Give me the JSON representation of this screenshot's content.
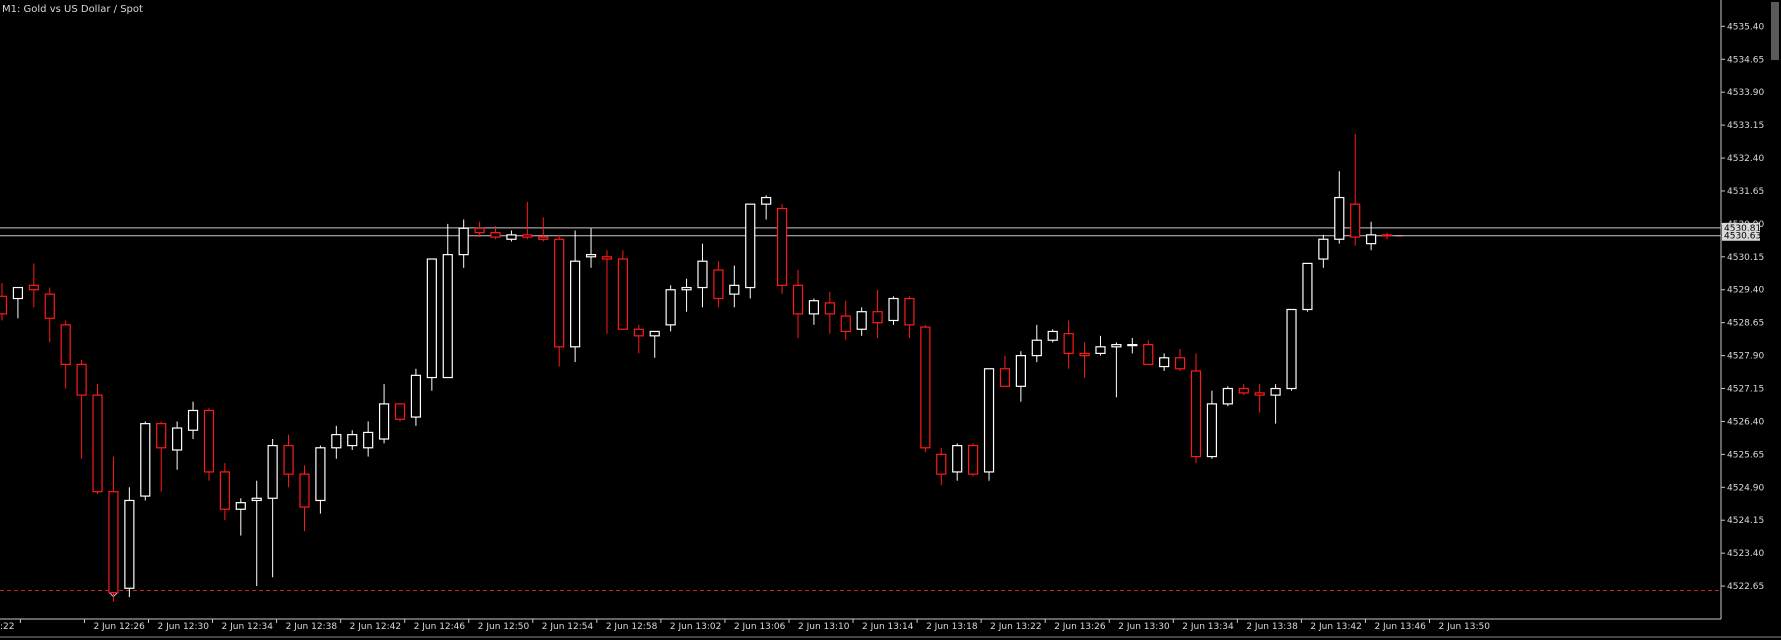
{
  "chart_data": {
    "type": "candlestick",
    "title": "M1:  Gold vs US Dollar / Spot",
    "up_color": "#ffffff",
    "down_color": "#ff1a1a",
    "background": "#000000",
    "ylim": [
      4521.9,
      4536.0
    ],
    "y_ticks": [
      "4535.40",
      "4534.65",
      "4533.90",
      "4533.15",
      "4532.40",
      "4531.65",
      "4530.90",
      "4530.15",
      "4529.40",
      "4528.65",
      "4527.90",
      "4527.15",
      "4526.40",
      "4525.65",
      "4524.90",
      "4524.15",
      "4523.40",
      "4522.65"
    ],
    "y_tick_values": [
      4535.4,
      4534.65,
      4533.9,
      4533.15,
      4532.4,
      4531.65,
      4530.9,
      4530.15,
      4529.4,
      4528.65,
      4527.9,
      4527.15,
      4526.4,
      4525.65,
      4524.9,
      4524.15,
      4523.4,
      4522.65
    ],
    "x_time_labels": [
      ":22",
      "2 Jun 12:26",
      "2 Jun 12:30",
      "2 Jun 12:34",
      "2 Jun 12:38",
      "2 Jun 12:42",
      "2 Jun 12:46",
      "2 Jun 12:50",
      "2 Jun 12:54",
      "2 Jun 12:58",
      "2 Jun 13:02",
      "2 Jun 13:06",
      "2 Jun 13:10",
      "2 Jun 13:14",
      "2 Jun 13:18",
      "2 Jun 13:22",
      "2 Jun 13:26",
      "2 Jun 13:30",
      "2 Jun 13:34",
      "2 Jun 13:38",
      "2 Jun 13:42",
      "2 Jun 13:46",
      "2 Jun 13:50"
    ],
    "horizontal_lines": [
      {
        "price": 4530.81,
        "label": "4530.81",
        "style": "solid",
        "color": "#c8c8c8"
      },
      {
        "price": 4530.63,
        "label": "4530.63",
        "style": "solid",
        "color": "#c8c8c8"
      },
      {
        "price": 4522.55,
        "label": "",
        "style": "dashed",
        "color": "#c0272d"
      }
    ],
    "candles": [
      [
        4529.25,
        4529.55,
        4528.7,
        4528.85
      ],
      [
        4529.2,
        4529.45,
        4528.75,
        4529.45
      ],
      [
        4529.5,
        4530.0,
        4529.0,
        4529.4
      ],
      [
        4529.3,
        4529.45,
        4528.2,
        4528.75
      ],
      [
        4528.6,
        4528.7,
        4527.15,
        4527.7
      ],
      [
        4527.7,
        4527.8,
        4525.55,
        4527.0
      ],
      [
        4527.0,
        4527.25,
        4524.75,
        4524.8
      ],
      [
        4524.8,
        4525.6,
        4522.3,
        4522.5
      ],
      [
        4522.6,
        4524.9,
        4522.4,
        4524.6
      ],
      [
        4524.7,
        4526.4,
        4524.6,
        4526.35
      ],
      [
        4526.35,
        4526.4,
        4524.8,
        4525.8
      ],
      [
        4525.75,
        4526.4,
        4525.3,
        4526.25
      ],
      [
        4526.2,
        4526.85,
        4526.0,
        4526.65
      ],
      [
        4526.65,
        4526.7,
        4525.05,
        4525.25
      ],
      [
        4525.25,
        4525.45,
        4524.15,
        4524.4
      ],
      [
        4524.4,
        4524.65,
        4523.8,
        4524.55
      ],
      [
        4524.6,
        4525.05,
        4522.65,
        4524.65
      ],
      [
        4524.65,
        4526.0,
        4522.85,
        4525.85
      ],
      [
        4525.85,
        4526.1,
        4524.9,
        4525.2
      ],
      [
        4525.2,
        4525.4,
        4523.9,
        4524.45
      ],
      [
        4524.6,
        4525.85,
        4524.3,
        4525.8
      ],
      [
        4525.8,
        4526.3,
        4525.55,
        4526.1
      ],
      [
        4525.85,
        4526.2,
        4525.75,
        4526.1
      ],
      [
        4525.8,
        4526.4,
        4525.6,
        4526.15
      ],
      [
        4526.0,
        4527.25,
        4525.9,
        4526.8
      ],
      [
        4526.8,
        4526.8,
        4526.4,
        4526.45
      ],
      [
        4526.5,
        4527.6,
        4526.3,
        4527.45
      ],
      [
        4527.4,
        4529.3,
        4527.1,
        4530.1
      ],
      [
        4527.4,
        4530.9,
        4527.4,
        4530.2
      ],
      [
        4530.2,
        4531.0,
        4529.9,
        4530.8
      ],
      [
        4530.8,
        4530.95,
        4530.6,
        4530.7
      ],
      [
        4530.7,
        4530.85,
        4530.55,
        4530.6
      ],
      [
        4530.55,
        4530.75,
        4530.5,
        4530.65
      ],
      [
        4530.65,
        4531.4,
        4530.55,
        4530.6
      ],
      [
        4530.6,
        4531.05,
        4530.5,
        4530.55
      ],
      [
        4530.55,
        4530.65,
        4527.65,
        4528.1
      ],
      [
        4528.1,
        4530.75,
        4527.75,
        4530.05
      ],
      [
        4530.15,
        4530.8,
        4529.9,
        4530.2
      ],
      [
        4530.15,
        4530.3,
        4528.4,
        4530.1
      ],
      [
        4530.1,
        4530.3,
        4528.55,
        4528.5
      ],
      [
        4528.5,
        4528.6,
        4527.95,
        4528.35
      ],
      [
        4528.35,
        4528.45,
        4527.85,
        4528.45
      ],
      [
        4528.6,
        4529.5,
        4528.45,
        4529.4
      ],
      [
        4529.4,
        4529.65,
        4528.9,
        4529.45
      ],
      [
        4529.45,
        4530.45,
        4529.0,
        4530.05
      ],
      [
        4529.85,
        4530.05,
        4529.0,
        4529.2
      ],
      [
        4529.3,
        4529.95,
        4529.0,
        4529.5
      ],
      [
        4529.45,
        4531.3,
        4529.2,
        4531.35
      ],
      [
        4531.35,
        4531.55,
        4531.0,
        4531.5
      ],
      [
        4531.25,
        4531.35,
        4529.3,
        4529.5
      ],
      [
        4529.5,
        4529.85,
        4528.3,
        4528.85
      ],
      [
        4528.85,
        4529.2,
        4528.6,
        4529.15
      ],
      [
        4529.1,
        4529.35,
        4528.4,
        4528.85
      ],
      [
        4528.8,
        4529.15,
        4528.25,
        4528.45
      ],
      [
        4528.5,
        4529.0,
        4528.35,
        4528.9
      ],
      [
        4528.9,
        4529.4,
        4528.3,
        4528.65
      ],
      [
        4528.7,
        4529.25,
        4528.6,
        4529.2
      ],
      [
        4529.2,
        4529.25,
        4528.3,
        4528.6
      ],
      [
        4528.55,
        4528.6,
        4525.7,
        4525.8
      ],
      [
        4525.65,
        4525.8,
        4524.95,
        4525.2
      ],
      [
        4525.25,
        4525.9,
        4525.05,
        4525.85
      ],
      [
        4525.85,
        4525.9,
        4525.15,
        4525.2
      ],
      [
        4525.25,
        4527.6,
        4525.05,
        4527.6
      ],
      [
        4527.6,
        4527.9,
        4527.2,
        4527.2
      ],
      [
        4527.2,
        4528.0,
        4526.85,
        4527.9
      ],
      [
        4527.9,
        4528.6,
        4527.75,
        4528.25
      ],
      [
        4528.25,
        4528.5,
        4528.2,
        4528.45
      ],
      [
        4528.4,
        4528.7,
        4527.6,
        4527.95
      ],
      [
        4527.95,
        4528.2,
        4527.4,
        4527.9
      ],
      [
        4527.95,
        4528.35,
        4527.9,
        4528.1
      ],
      [
        4528.1,
        4528.2,
        4526.95,
        4528.15
      ],
      [
        4528.15,
        4528.3,
        4527.95,
        4528.15
      ],
      [
        4528.15,
        4528.25,
        4527.7,
        4527.7
      ],
      [
        4527.65,
        4527.95,
        4527.55,
        4527.85
      ],
      [
        4527.85,
        4528.05,
        4527.55,
        4527.6
      ],
      [
        4527.55,
        4527.95,
        4525.45,
        4525.6
      ],
      [
        4525.6,
        4527.1,
        4525.55,
        4526.8
      ],
      [
        4526.8,
        4527.2,
        4526.75,
        4527.15
      ],
      [
        4527.15,
        4527.25,
        4527.0,
        4527.05
      ],
      [
        4527.05,
        4527.25,
        4526.6,
        4527.0
      ],
      [
        4527.0,
        4527.25,
        4526.35,
        4527.15
      ],
      [
        4527.15,
        4528.95,
        4527.1,
        4528.95
      ],
      [
        4528.95,
        4530.0,
        4528.9,
        4530.0
      ],
      [
        4530.1,
        4530.65,
        4529.9,
        4530.55
      ],
      [
        4530.55,
        4532.1,
        4530.45,
        4531.5
      ],
      [
        4531.35,
        4532.95,
        4530.4,
        4530.6
      ],
      [
        4530.45,
        4530.95,
        4530.3,
        4530.65
      ],
      [
        4530.65,
        4530.7,
        4530.55,
        4530.63
      ]
    ]
  }
}
